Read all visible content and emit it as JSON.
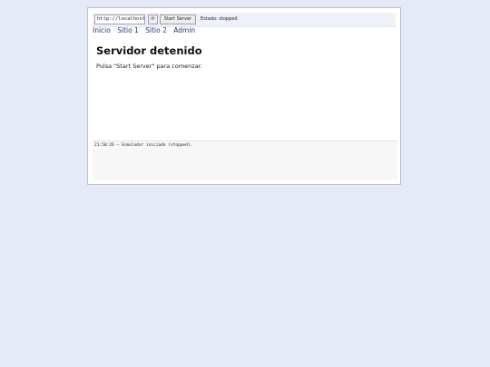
{
  "toolbar": {
    "url_value": "http://localhost/",
    "go_label": "⟳",
    "start_label": "Start Server",
    "status_text": "Estado: stopped"
  },
  "nav": {
    "items": [
      {
        "label": "Inicio"
      },
      {
        "label": "Sitio 1"
      },
      {
        "label": "Sitio 2"
      },
      {
        "label": "Admin"
      }
    ]
  },
  "main": {
    "title": "Servidor detenido",
    "message": "Pulsa \"Start Server\" para comenzar."
  },
  "log": {
    "lines": [
      "21:50:26 — Simulador iniciado (stopped)."
    ]
  },
  "colors": {
    "background": "#e4eaf7",
    "link": "#1a3d6e"
  }
}
